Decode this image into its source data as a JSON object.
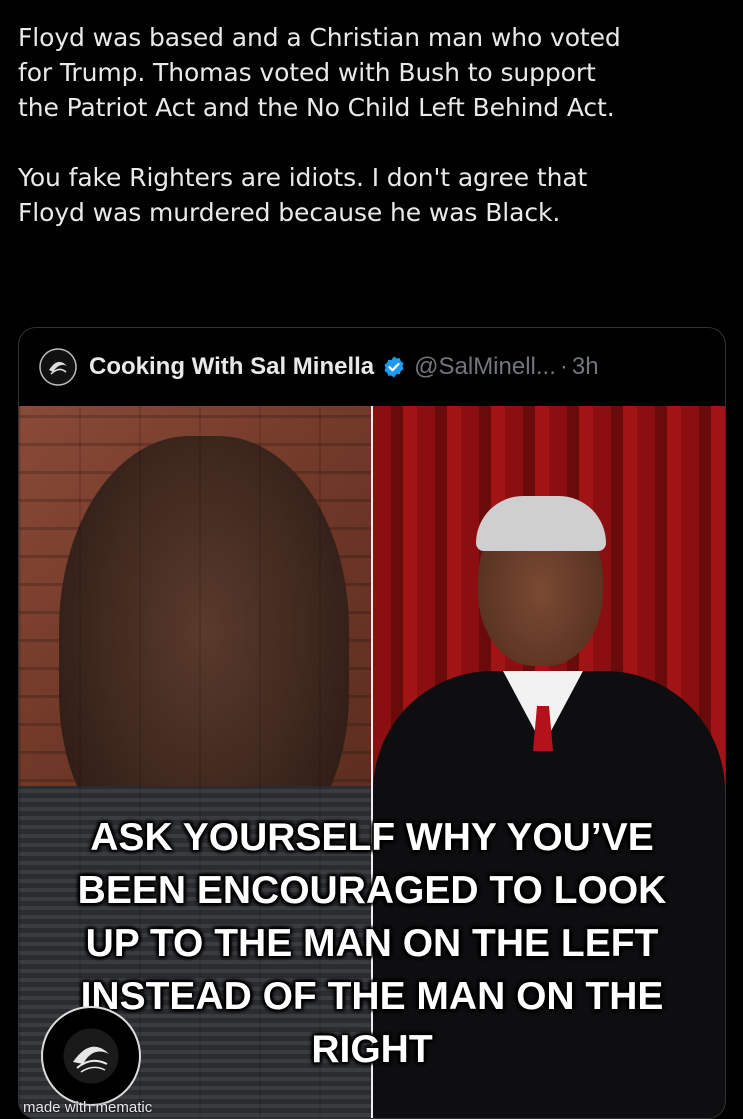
{
  "tweet": {
    "paragraph_1": "Floyd was based and a Christian man who voted\nfor Trump. Thomas voted with Bush to support\nthe Patriot Act and the No Child Left Behind Act.",
    "paragraph_2": "You fake Righters are idiots. I don't agree that\nFloyd was murdered because he was Black."
  },
  "quote": {
    "display_name": "Cooking With Sal Minella",
    "handle": "@SalMinell...",
    "separator": "·",
    "time": "3h",
    "meme": {
      "caption_lines": [
        "ASK YOURSELF WHY YOU’VE",
        "BEEN ENCOURAGED TO LOOK",
        "UP TO THE MAN ON THE LEFT",
        "INSTEAD OF THE MAN ON THE",
        "RIGHT"
      ],
      "watermark": "made with mematic"
    }
  },
  "colors": {
    "background": "#000000",
    "text": "#e7e9ea",
    "secondary_text": "#71767b",
    "verified_blue": "#1d9bf0",
    "card_border": "#2f3336"
  },
  "icons": {
    "verified": "verified-badge-icon",
    "avatar": "sal-minella-logo-avatar"
  }
}
